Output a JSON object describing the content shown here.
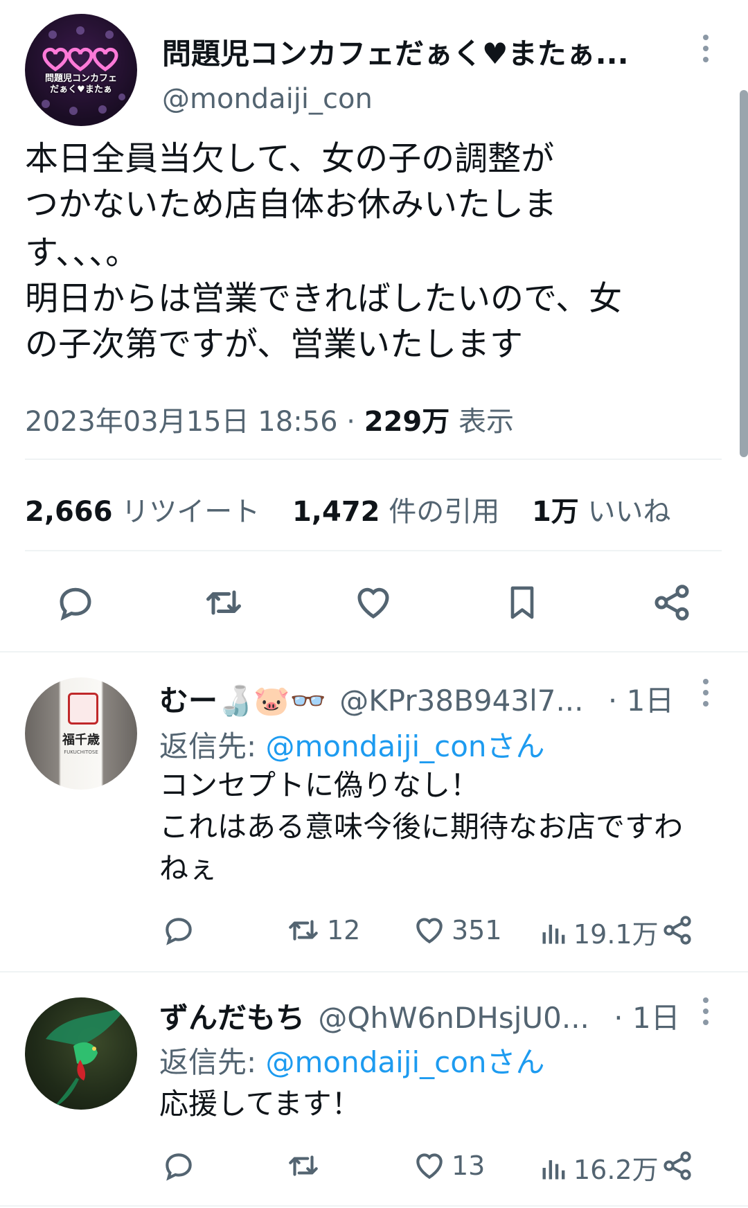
{
  "main_tweet": {
    "display_name": "問題児コンカフェだぁく♥またぁ...",
    "handle": "@mondaiji_con",
    "avatar_text": [
      "問題児コンカフェ",
      "だぁく♥またぁ"
    ],
    "text_lines": [
      "本日全員当欠して、女の子の調整が",
      "つかないため店自体お休みいたしま",
      "す、、、。",
      "明日からは営業できればしたいので、女",
      "の子次第ですが、営業いたします"
    ],
    "timestamp": "2023年03月15日 18:56 · ",
    "views_count": "229万",
    "views_label": " 表示",
    "stats": {
      "retweets": "2,666",
      "retweets_label": " リツイート",
      "quotes": "1,472",
      "quotes_label": " 件の引用",
      "likes": "1万",
      "likes_label": " いいね"
    }
  },
  "replies": [
    {
      "display_name": "むー🍶🐷👓",
      "handle": "@KPr38B943l7...",
      "time": "· 1日",
      "reply_to_label": "返信先: ",
      "reply_to_handle": "@mondaiji_conさん",
      "text_lines": [
        "コンセプトに偽りなし！",
        "これはある意味今後に期待なお店ですわ",
        "ねぇ"
      ],
      "avatar_text": [
        "福千歳",
        "FUKUCHITOSE"
      ],
      "retweets": "12",
      "likes": "351",
      "views": "19.1万"
    },
    {
      "display_name": "ずんだもち",
      "handle": "@QhW6nDHsjU0...",
      "time": "· 1日",
      "reply_to_label": "返信先: ",
      "reply_to_handle": "@mondaiji_conさん",
      "text_lines": [
        "応援してます！"
      ],
      "retweets": "",
      "likes": "13",
      "views": "16.2万"
    }
  ],
  "colors": {
    "accent": "#1d9bf0",
    "text": "#0f1419",
    "secondary": "#536471",
    "divider": "#eff3f4"
  },
  "icons": [
    "reply-icon",
    "retweet-icon",
    "like-icon",
    "bookmark-icon",
    "share-icon",
    "views-icon",
    "more-icon"
  ]
}
